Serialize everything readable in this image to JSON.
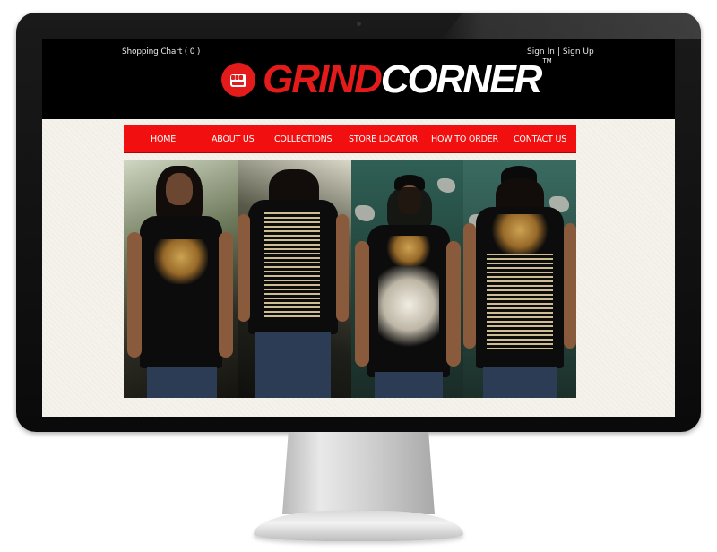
{
  "site": {
    "logo_part1": "GRIND",
    "logo_part2": "CORNER",
    "logo_tm": "TM",
    "cart_label": "Shopping Chart ( 0 )",
    "sign_in": "Sign In",
    "separator": "|",
    "sign_up": "Sign Up"
  },
  "nav": {
    "items": [
      {
        "label": "HOME"
      },
      {
        "label": "ABOUT US"
      },
      {
        "label": "COLLECTIONS"
      },
      {
        "label": "STORE LOCATOR"
      },
      {
        "label": "HOW TO ORDER"
      },
      {
        "label": "CONTACT US"
      }
    ]
  },
  "colors": {
    "brand_red": "#e31b1b",
    "nav_red": "#f20f0f",
    "header_bg": "#000000"
  },
  "hero": {
    "icon": "tshirt-photo-collage"
  }
}
